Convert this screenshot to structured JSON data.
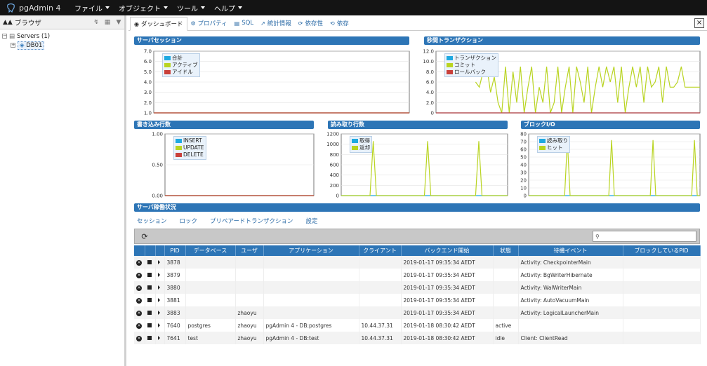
{
  "app": {
    "name": "pgAdmin 4"
  },
  "menu": [
    "ファイル",
    "オブジェクト",
    "ツール",
    "ヘルプ"
  ],
  "browser": {
    "title": "ブラウザ",
    "tree": {
      "servers_label": "Servers (1)",
      "server_label": "DB01"
    }
  },
  "tabs": [
    {
      "label": "ダッシュボード",
      "icon": "dashboard-icon"
    },
    {
      "label": "プロパティ",
      "icon": "gears-icon"
    },
    {
      "label": "SQL",
      "icon": "file-icon"
    },
    {
      "label": "統計情報",
      "icon": "line-chart-icon"
    },
    {
      "label": "依存性",
      "icon": "dependency-icon"
    },
    {
      "label": "依存",
      "icon": "dependent-icon"
    }
  ],
  "colors": {
    "blue": "#1ea9e1",
    "green": "#b9d421",
    "red": "#c9403b",
    "header": "#2d75b6"
  },
  "chart_data": [
    {
      "id": "sessions",
      "type": "line",
      "title": "サーバセッション",
      "yticks": [
        "1.0",
        "2.0",
        "3.0",
        "4.0",
        "5.0",
        "6.0",
        "7.0"
      ],
      "ylim": [
        1,
        7
      ],
      "series": [
        {
          "name": "合計",
          "color": "#1ea9e1",
          "values": [
            1,
            1,
            1,
            1,
            1,
            1,
            1,
            1,
            1,
            1
          ]
        },
        {
          "name": "アクティブ",
          "color": "#b9d421",
          "values": [
            1,
            1,
            1,
            1,
            1,
            1,
            1,
            1,
            1,
            1
          ]
        },
        {
          "name": "アイドル",
          "color": "#c9403b",
          "values": [
            1,
            1,
            1,
            1,
            1,
            1,
            1,
            1,
            1,
            1
          ]
        }
      ]
    },
    {
      "id": "tps",
      "type": "line",
      "title": "秒間トランザクション",
      "yticks": [
        "0",
        "2.0",
        "4.0",
        "6.0",
        "8.0",
        "10.0",
        "12.0"
      ],
      "ylim": [
        0,
        12
      ],
      "series": [
        {
          "name": "トランザクション",
          "color": "#1ea9e1",
          "values": [
            0
          ]
        },
        {
          "name": "コミット",
          "color": "#b9d421",
          "values": [
            6,
            5,
            8,
            9,
            4,
            7,
            2,
            0,
            9,
            0,
            8,
            2,
            9,
            0,
            5,
            9,
            0,
            5,
            2,
            9,
            0,
            2,
            9,
            0,
            5,
            9,
            0,
            9,
            6,
            2,
            9,
            0,
            5,
            9,
            5,
            9,
            6,
            9,
            2,
            9,
            0,
            5,
            9,
            5,
            9,
            2,
            9,
            5,
            6,
            9,
            2,
            9,
            5,
            5,
            6,
            9,
            5,
            5,
            5,
            5,
            5
          ]
        },
        {
          "name": "ロールバック",
          "color": "#c9403b",
          "values": [
            0
          ]
        }
      ]
    },
    {
      "id": "writes",
      "type": "line",
      "title": "書き込み行数",
      "yticks": [
        "0.00",
        "0.50",
        "1.00"
      ],
      "ylim": [
        0,
        1
      ],
      "series": [
        {
          "name": "INSERT",
          "color": "#1ea9e1",
          "values": [
            0,
            0,
            0,
            0,
            0
          ]
        },
        {
          "name": "UPDATE",
          "color": "#b9d421",
          "values": [
            0,
            0,
            0,
            0,
            0
          ]
        },
        {
          "name": "DELETE",
          "color": "#c9403b",
          "values": [
            0,
            0,
            0,
            0,
            0
          ]
        }
      ]
    },
    {
      "id": "reads",
      "type": "line",
      "title": "読み取り行数",
      "yticks": [
        "0",
        "200",
        "400",
        "600",
        "800",
        "1000",
        "1200"
      ],
      "ylim": [
        0,
        1200
      ],
      "series": [
        {
          "name": "取得",
          "color": "#1ea9e1",
          "values": [
            0
          ]
        },
        {
          "name": "返却",
          "color": "#b9d421",
          "values": [
            0,
            0,
            0,
            0,
            0,
            0,
            0,
            0,
            0,
            0,
            1060,
            0,
            0,
            0,
            0,
            0,
            0,
            0,
            0,
            0,
            0,
            0,
            0,
            0,
            0,
            0,
            0,
            1060,
            0,
            0,
            0,
            0,
            0,
            0,
            0,
            0,
            0,
            0,
            0,
            0,
            0,
            0,
            0,
            1060,
            0,
            0,
            0,
            0,
            0,
            0,
            0,
            0,
            0
          ]
        }
      ]
    },
    {
      "id": "blockio",
      "type": "line",
      "title": "ブロックI/O",
      "yticks": [
        "0",
        "10",
        "20",
        "30",
        "40",
        "50",
        "60",
        "70",
        "80"
      ],
      "ylim": [
        0,
        80
      ],
      "series": [
        {
          "name": "読み取り",
          "color": "#1ea9e1",
          "values": [
            0
          ]
        },
        {
          "name": "ヒット",
          "color": "#b9d421",
          "values": [
            0,
            0,
            0,
            0,
            0,
            0,
            0,
            0,
            0,
            0,
            0,
            0,
            0,
            0,
            72,
            0,
            0,
            0,
            0,
            0,
            0,
            0,
            0,
            0,
            0,
            0,
            0,
            0,
            0,
            0,
            72,
            0,
            0,
            0,
            0,
            0,
            0,
            0,
            0,
            0,
            0,
            0,
            0,
            0,
            0,
            72,
            0,
            0,
            0,
            0,
            0,
            0,
            0,
            0,
            0,
            0,
            0,
            0,
            0,
            0,
            72,
            0,
            0
          ]
        }
      ]
    }
  ],
  "activity": {
    "title": "サーバ稼働状況",
    "subtabs": [
      "セッション",
      "ロック",
      "プリペアードトランザクション",
      "設定"
    ],
    "columns": [
      "PID",
      "データベース",
      "ユーザ",
      "アプリケーション",
      "クライアント",
      "バックエンド開始",
      "状態",
      "待機イベント",
      "ブロックしているPID"
    ],
    "rows": [
      [
        "3878",
        "",
        "",
        "",
        "",
        "2019-01-17 09:35:34 AEDT",
        "",
        "Activity: CheckpointerMain",
        ""
      ],
      [
        "3879",
        "",
        "",
        "",
        "",
        "2019-01-17 09:35:34 AEDT",
        "",
        "Activity: BgWriterHibernate",
        ""
      ],
      [
        "3880",
        "",
        "",
        "",
        "",
        "2019-01-17 09:35:34 AEDT",
        "",
        "Activity: WalWriterMain",
        ""
      ],
      [
        "3881",
        "",
        "",
        "",
        "",
        "2019-01-17 09:35:34 AEDT",
        "",
        "Activity: AutoVacuumMain",
        ""
      ],
      [
        "3883",
        "",
        "zhaoyu",
        "",
        "",
        "2019-01-17 09:35:34 AEDT",
        "",
        "Activity: LogicalLauncherMain",
        ""
      ],
      [
        "7640",
        "postgres",
        "zhaoyu",
        "pgAdmin 4 - DB:postgres",
        "10.44.37.31",
        "2019-01-18 08:30:42 AEDT",
        "active",
        "",
        ""
      ],
      [
        "7641",
        "test",
        "zhaoyu",
        "pgAdmin 4 - DB:test",
        "10.44.37.31",
        "2019-01-18 08:30:42 AEDT",
        "idle",
        "Client: ClientRead",
        ""
      ]
    ]
  }
}
